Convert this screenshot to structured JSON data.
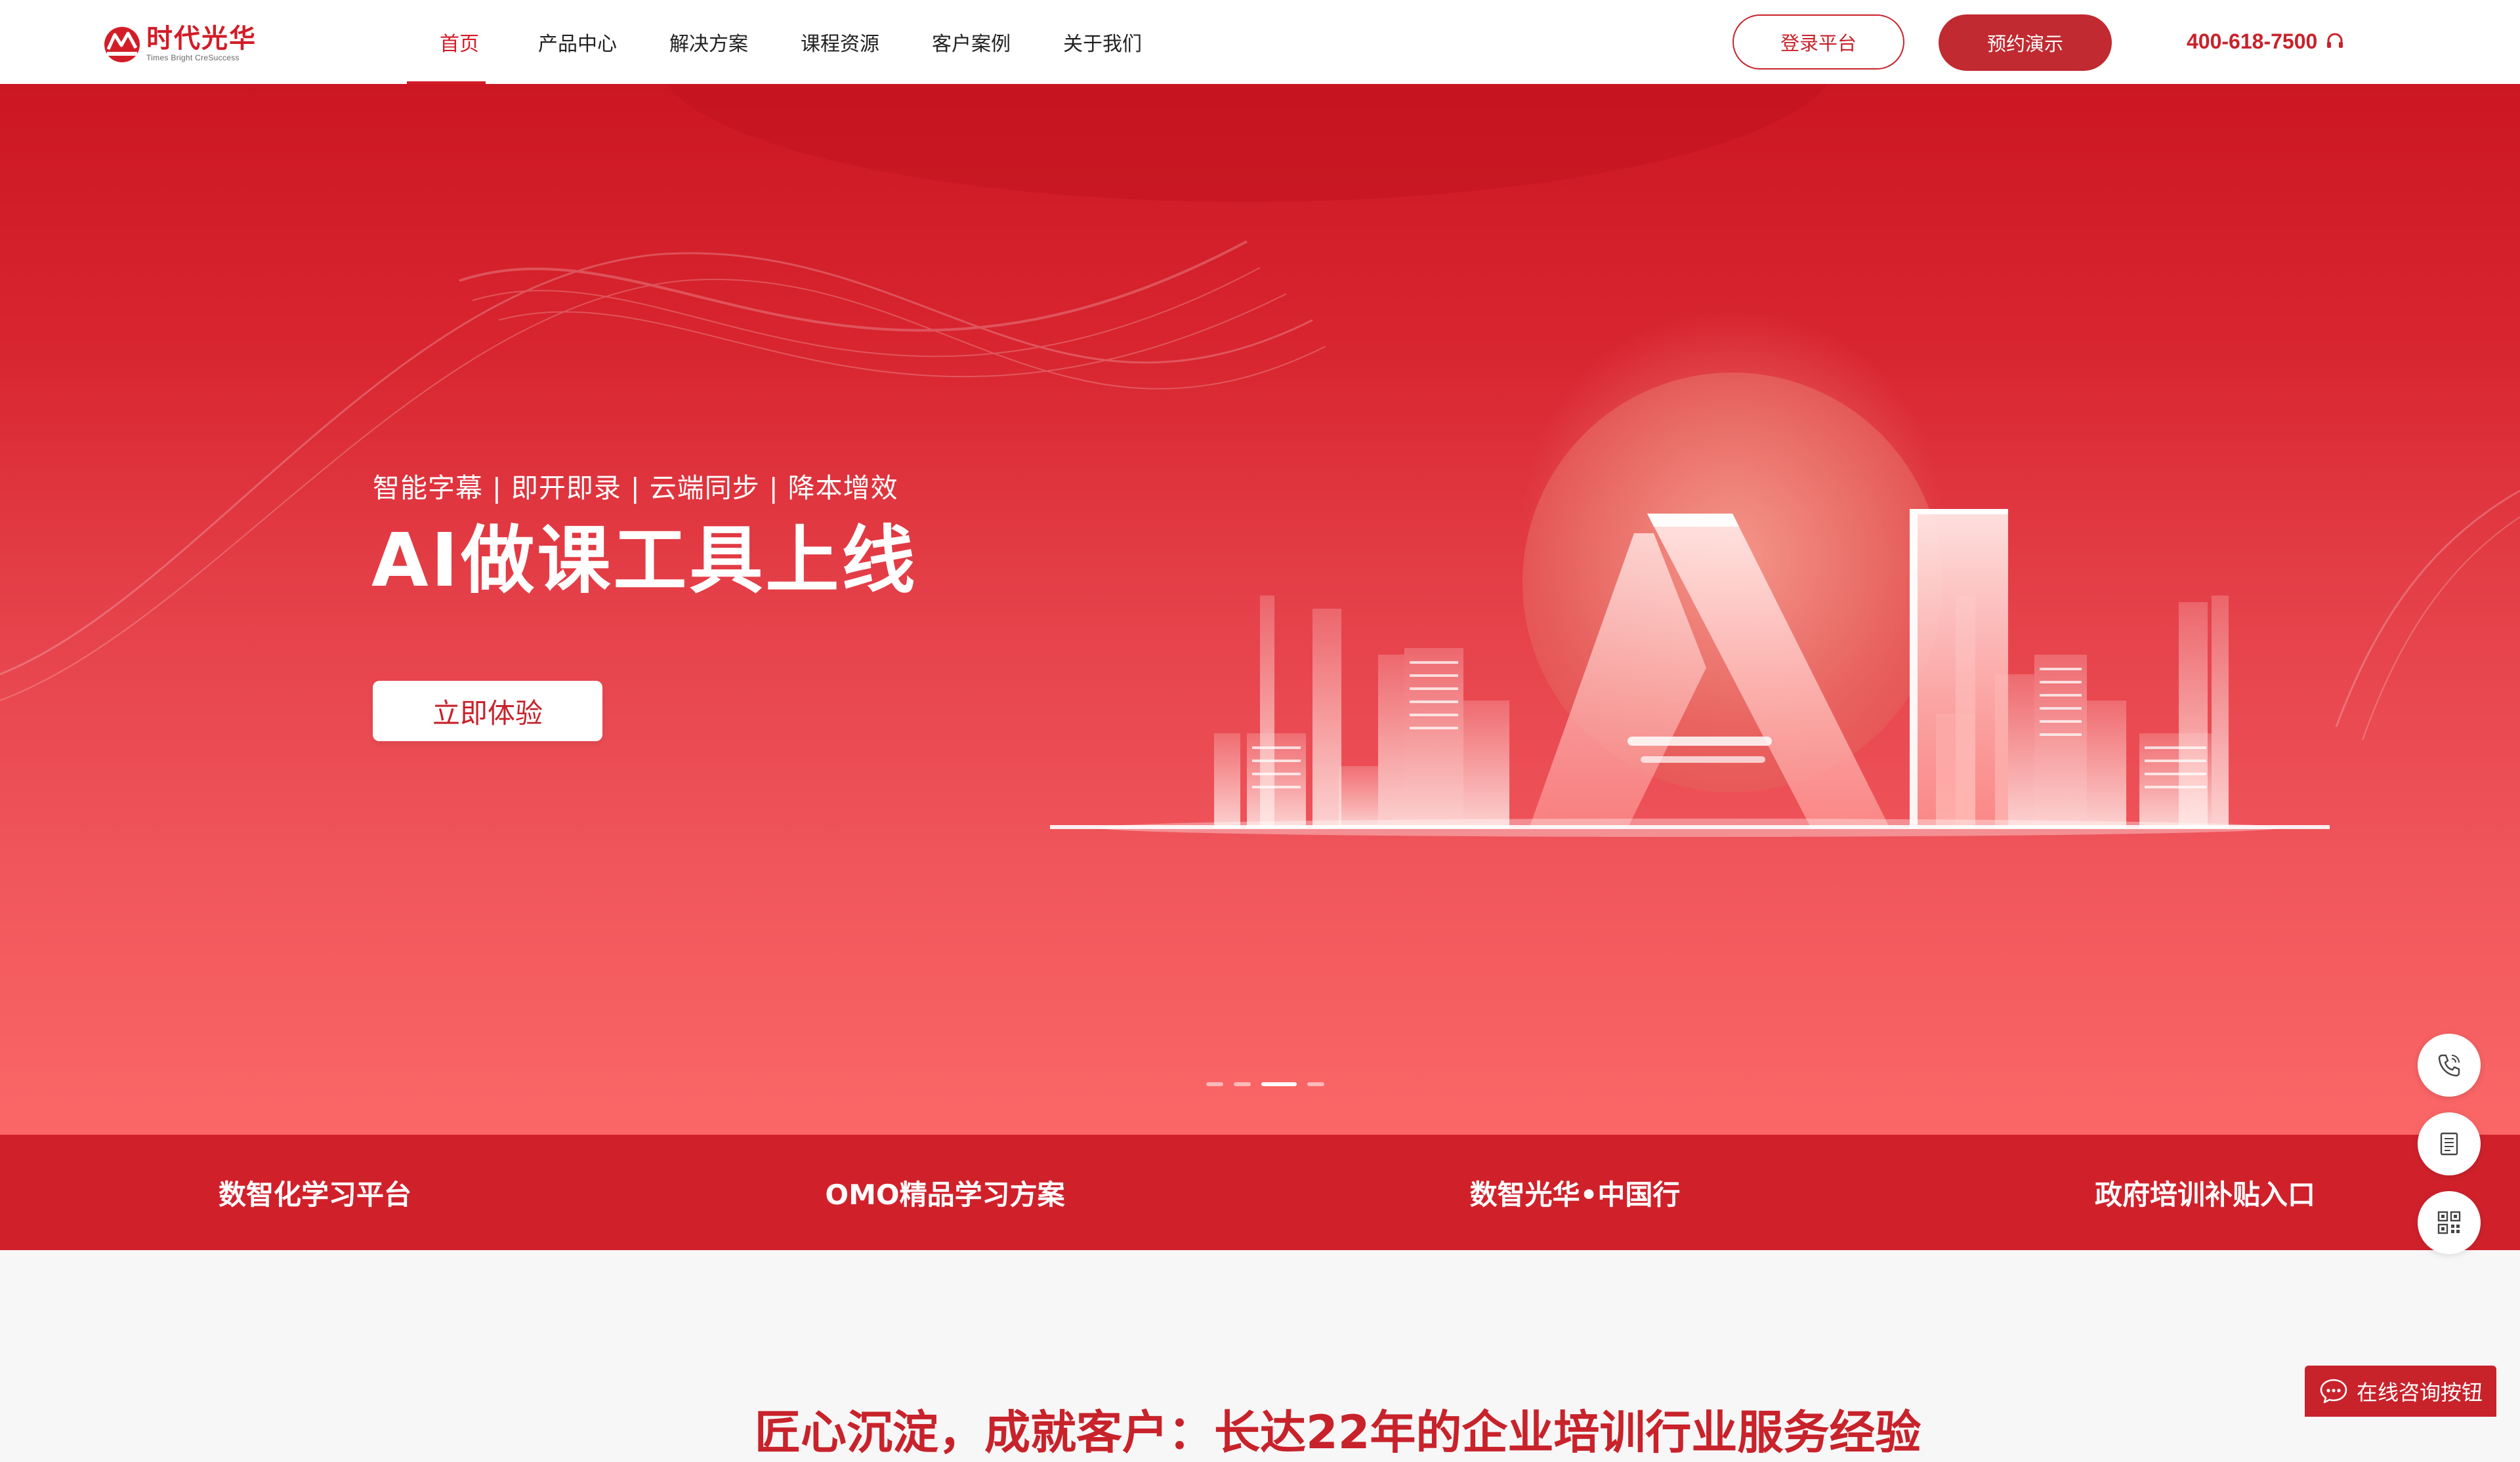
{
  "brand": {
    "name_cn": "时代光华",
    "name_en": "Times Bright CreSuccess",
    "color": "#d21d28"
  },
  "nav": {
    "items": [
      {
        "label": "首页",
        "active": true
      },
      {
        "label": "产品中心",
        "active": false
      },
      {
        "label": "解决方案",
        "active": false
      },
      {
        "label": "课程资源",
        "active": false
      },
      {
        "label": "客户案例",
        "active": false
      },
      {
        "label": "关于我们",
        "active": false
      }
    ]
  },
  "header": {
    "login_label": "登录平台",
    "demo_label": "预约演示",
    "phone": "400-618-7500",
    "phone_icon": "headset-icon"
  },
  "hero": {
    "tagline": "智能字幕 | 即开即录 | 云端同步 | 降本增效",
    "title": "AI做课工具上线",
    "cta_label": "立即体验",
    "slide_count": 4,
    "active_slide": 3
  },
  "features": [
    {
      "label": "数智化学习平台"
    },
    {
      "label": "OMO精品学习方案"
    },
    {
      "label": "数智光华•中国行"
    },
    {
      "label": "政府培训补贴入口"
    }
  ],
  "section": {
    "title": "匠心沉淀，成就客户：长达22年的企业培训行业服务经验"
  },
  "float_tools": [
    {
      "icon": "phone-icon"
    },
    {
      "icon": "document-icon"
    },
    {
      "icon": "qrcode-icon"
    }
  ],
  "chat": {
    "label": "在线咨询按钮",
    "icon": "chat-bubble-icon"
  }
}
